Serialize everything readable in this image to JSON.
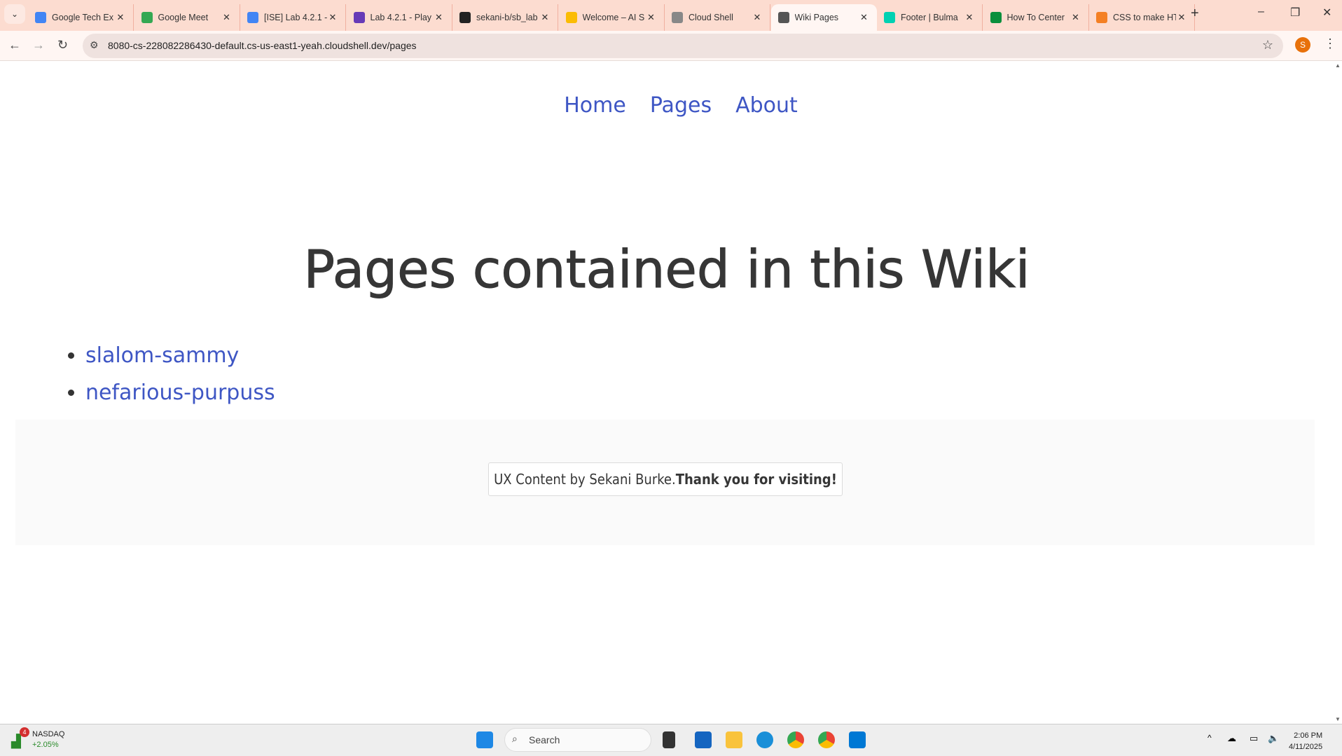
{
  "browser": {
    "tabs": [
      {
        "title": "Google Tech Ex",
        "color": "#4285f4"
      },
      {
        "title": "Google Meet",
        "color": "#34a853"
      },
      {
        "title": "[ISE] Lab 4.2.1 -",
        "color": "#4285f4"
      },
      {
        "title": "Lab 4.2.1 - Play",
        "color": "#673ab7"
      },
      {
        "title": "sekani-b/sb_lab",
        "color": "#222222"
      },
      {
        "title": "Welcome – AI S",
        "color": "#fbbc04"
      },
      {
        "title": "Cloud Shell",
        "color": "#888888"
      },
      {
        "title": "Wiki Pages",
        "color": "#555555",
        "active": true
      },
      {
        "title": "Footer | Bulma",
        "color": "#00d1b2"
      },
      {
        "title": "How To Center",
        "color": "#0a8f3c"
      },
      {
        "title": "CSS to make HT",
        "color": "#f48024"
      }
    ],
    "url": "8080-cs-228082286430-default.cs-us-east1-yeah.cloudshell.dev/pages",
    "profile_initial": "S"
  },
  "page": {
    "nav": [
      "Home",
      "Pages",
      "About"
    ],
    "title": "Pages contained in this Wiki",
    "pages": [
      "slalom-sammy",
      "nefarious-purpuss"
    ],
    "footer": {
      "text": "UX Content by Sekani Burke.",
      "bold": "Thank you for visiting!"
    }
  },
  "taskbar": {
    "widget_name": "NASDAQ",
    "widget_change": "+2.05%",
    "widget_badge": "4",
    "search_placeholder": "Search",
    "time": "2:06 PM",
    "date": "4/11/2025"
  }
}
